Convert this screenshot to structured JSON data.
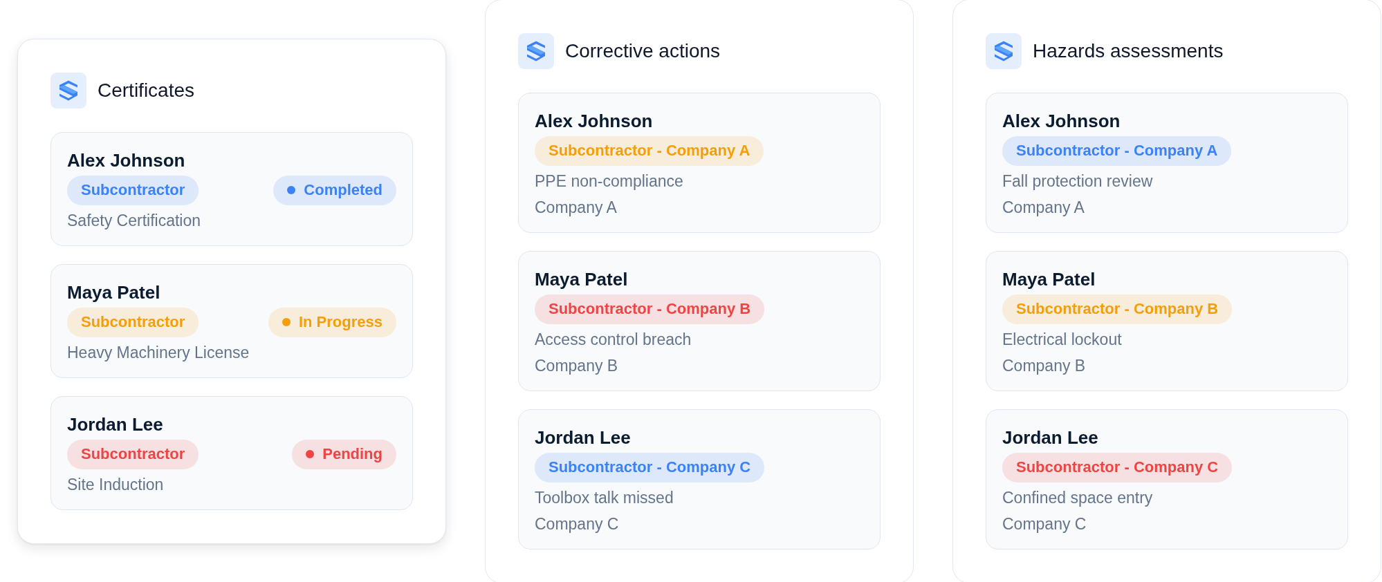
{
  "panels": [
    {
      "title": "Certificates",
      "elevated": true,
      "items": [
        {
          "name": "Alex Johnson",
          "tag": {
            "label": "Subcontractor",
            "color": "#3b82f6"
          },
          "status": {
            "label": "Completed",
            "color": "#3b82f6"
          },
          "details": [
            "Safety Certification"
          ]
        },
        {
          "name": "Maya Patel",
          "tag": {
            "label": "Subcontractor",
            "color": "#f59e0b"
          },
          "status": {
            "label": "In Progress",
            "color": "#f59e0b"
          },
          "details": [
            "Heavy Machinery License"
          ]
        },
        {
          "name": "Jordan Lee",
          "tag": {
            "label": "Subcontractor",
            "color": "#ef4444"
          },
          "status": {
            "label": "Pending",
            "color": "#ef4444"
          },
          "details": [
            "Site Induction"
          ]
        }
      ]
    },
    {
      "title": "Corrective actions",
      "elevated": false,
      "items": [
        {
          "name": "Alex Johnson",
          "tag": {
            "label": "Subcontractor - Company A",
            "color": "#f59e0b"
          },
          "details": [
            "PPE non-compliance",
            "Company A"
          ]
        },
        {
          "name": "Maya Patel",
          "tag": {
            "label": "Subcontractor - Company B",
            "color": "#ef4444"
          },
          "details": [
            "Access control breach",
            "Company B"
          ]
        },
        {
          "name": "Jordan Lee",
          "tag": {
            "label": "Subcontractor - Company C",
            "color": "#3b82f6"
          },
          "details": [
            "Toolbox talk missed",
            "Company C"
          ]
        }
      ]
    },
    {
      "title": "Hazards assessments",
      "elevated": false,
      "items": [
        {
          "name": "Alex Johnson",
          "tag": {
            "label": "Subcontractor - Company A",
            "color": "#3b82f6"
          },
          "details": [
            "Fall protection review",
            "Company A"
          ]
        },
        {
          "name": "Maya Patel",
          "tag": {
            "label": "Subcontractor - Company B",
            "color": "#f59e0b"
          },
          "details": [
            "Electrical lockout",
            "Company B"
          ]
        },
        {
          "name": "Jordan Lee",
          "tag": {
            "label": "Subcontractor - Company C",
            "color": "#ef4444"
          },
          "details": [
            "Confined space entry",
            "Company C"
          ]
        }
      ]
    }
  ]
}
